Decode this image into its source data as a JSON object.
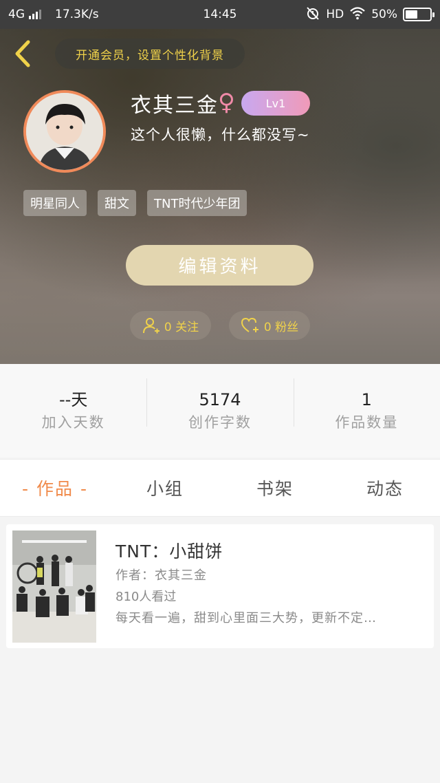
{
  "status_bar": {
    "network": "4G",
    "speed": "17.3K/s",
    "time": "14:45",
    "hd": "HD",
    "battery": "50%"
  },
  "header": {
    "vip_text": "开通会员，设置个性化背景",
    "username": "衣其三金",
    "gender_symbol": "♀",
    "level": "Lv1",
    "bio": "这个人很懒，什么都没写~",
    "tags": [
      "明星同人",
      "甜文",
      "TNT时代少年团"
    ],
    "edit_button": "编辑资料",
    "following": "0 关注",
    "followers": "0 粉丝"
  },
  "stats": [
    {
      "value": "--天",
      "label": "加入天数"
    },
    {
      "value": "5174",
      "label": "创作字数"
    },
    {
      "value": "1",
      "label": "作品数量"
    }
  ],
  "tabs": [
    "- 作品 -",
    "小组",
    "书架",
    "动态"
  ],
  "books": [
    {
      "title": "TNT：小甜饼",
      "author": "作者：衣其三金",
      "views": "810人看过",
      "description": "每天看一遍，甜到心里面三大势，更新不定…"
    }
  ],
  "colors": {
    "accent_orange": "#f08a4a",
    "vip_gold": "#f0d24a",
    "edit_button_bg": "#e3d6b0",
    "level_badge": "#e0a8d8"
  }
}
